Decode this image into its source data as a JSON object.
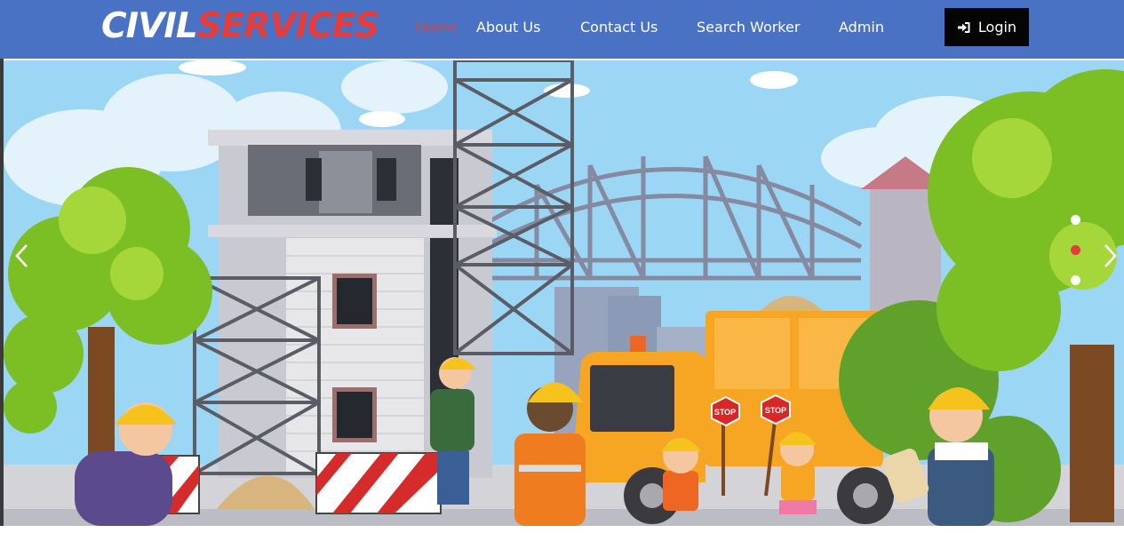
{
  "brand": {
    "part1": "CIVIL",
    "part2": "SERVICES"
  },
  "nav": {
    "home": "Home",
    "about": "About Us",
    "contact": "Contact Us",
    "search": "Search Worker",
    "admin": "Admin",
    "login": "Login"
  },
  "hero": {
    "stop_sign_1": "STOP",
    "stop_sign_2": "STOP",
    "active_slide": 2,
    "slide_count": 3
  },
  "colors": {
    "navbar": "#4a72c4",
    "brand_accent": "#e53b3b",
    "login_button": "#050505",
    "active_dot": "#e53b3b"
  },
  "icons": [
    "sign-in-icon",
    "chevron-left-icon",
    "chevron-right-icon"
  ]
}
